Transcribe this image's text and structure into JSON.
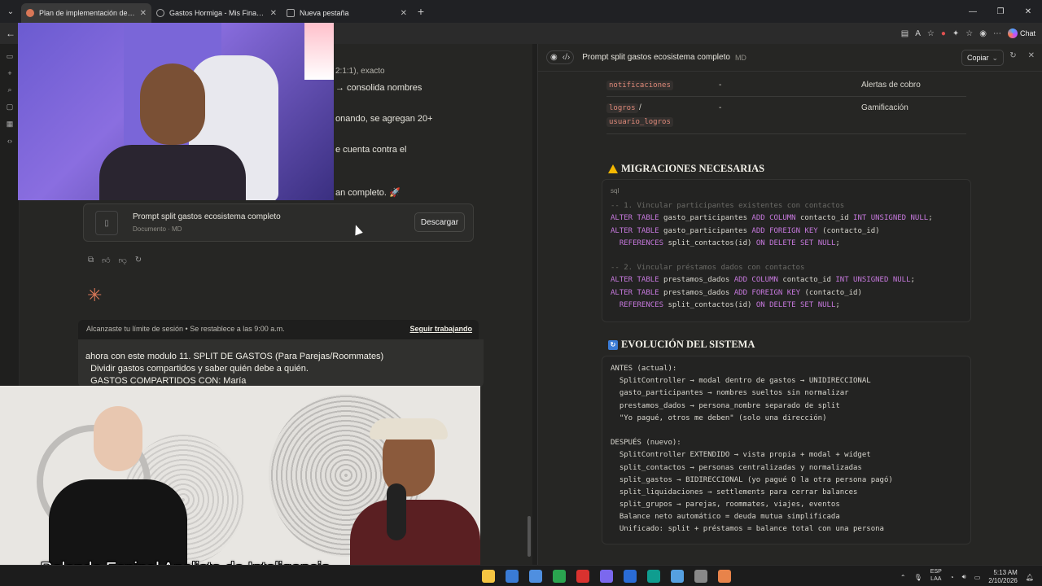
{
  "browser": {
    "tabs": [
      {
        "title": "Plan de implementación de flujo d",
        "active": true,
        "color": "#d97757"
      },
      {
        "title": "Gastos Hormiga - Mis Finanzas",
        "active": false,
        "color": "#888888"
      },
      {
        "title": "Nueva pestaña",
        "active": false,
        "color": "#888888"
      }
    ],
    "chat_label": "Chat"
  },
  "chat": {
    "partial_lines": [
      "2:1:1), exacto",
      "→ consolida nombres",
      "onando, se agregan 20+",
      "e cuenta contra el",
      "an completo. 🚀"
    ],
    "artifact_card": {
      "title": "Prompt split gastos ecosistema completo",
      "subtitle": "Documento · MD",
      "download_label": "Descargar"
    },
    "limit_bar": {
      "text": "Alcanzaste tu límite de sesión • Se restablece a las 9:00 a.m.",
      "button": "Seguir trabajando"
    },
    "input_lines": [
      "ahora con este modulo 11. SPLIT DE GASTOS (Para Parejas/Roommates)",
      "  Dividir gastos compartidos y saber quién debe a quién.",
      "  GASTOS COMPARTIDOS CON: María"
    ]
  },
  "panel": {
    "title": "Prompt split gastos ecosistema completo",
    "ext": "MD",
    "copy_label": "Copiar",
    "table_rows": [
      {
        "table": "notificaciones",
        "col2": "-",
        "purpose": "Alertas de cobro"
      },
      {
        "table": "logros",
        "table_extra": "usuario_logros",
        "sep": "/",
        "col2": "-",
        "purpose": "Gamificación"
      }
    ],
    "migrations": {
      "heading": "MIGRACIONES NECESARIAS",
      "lang": "sql",
      "comment1": "-- 1. Vincular participantes existentes con contactos",
      "line1a": "gasto_participantes",
      "line1b": "contacto_id",
      "line2a": "gasto_participantes",
      "line2b": "(contacto_id)",
      "line3": "split_contactos(id)",
      "comment2": "-- 2. Vincular préstamos dados con contactos",
      "line4a": "prestamos_dados",
      "line4b": "contacto_id",
      "line5a": "prestamos_dados",
      "line5b": "(contacto_id)",
      "line6": "split_contactos(id)",
      "kw_alter": "ALTER TABLE",
      "kw_add_column": "ADD COLUMN",
      "kw_int": "INT UNSIGNED",
      "kw_null": "NULL",
      "kw_add_fk": "ADD FOREIGN KEY",
      "kw_references": "REFERENCES",
      "kw_ondelete": "ON DELETE SET",
      "semicolon": ";"
    },
    "evolution": {
      "heading": "EVOLUCIÓN DEL SISTEMA",
      "lines": [
        "ANTES (actual):",
        "  SplitController → modal dentro de gastos → UNIDIRECCIONAL",
        "  gasto_participantes → nombres sueltos sin normalizar",
        "  prestamos_dados → persona_nombre separado de split",
        "  \"Yo pagué, otros me deben\" (solo una dirección)",
        "",
        "DESPUÉS (nuevo):",
        "  SplitController EXTENDIDO → vista propia + modal + widget",
        "  split_contactos → personas centralizadas y normalizadas",
        "  split_gastos → BIDIRECCIONAL (yo pagué O la otra persona pagó)",
        "  split_liquidaciones → settlements para cerrar balances",
        "  split_grupos → parejas, roommates, viajes, eventos",
        "  Balance neto automático = deuda mutua simplificada",
        "  Unificado: split + préstamos = balance total con una persona"
      ]
    }
  },
  "overlay": {
    "caption": "Rolando Espinal Analista de Inteligencia"
  },
  "taskbar": {
    "lang_line1": "ESP",
    "lang_line2": "LAA",
    "time": "5:13 AM",
    "date": "2/10/2026",
    "apps": [
      "#f5c542",
      "#3a7bd5",
      "#4f8fe0",
      "#2aa44f",
      "#d9322f",
      "#7b68ee",
      "#2a6cd6",
      "#0f9d8f",
      "#55a0e0",
      "#888888",
      "#e8834a"
    ]
  }
}
